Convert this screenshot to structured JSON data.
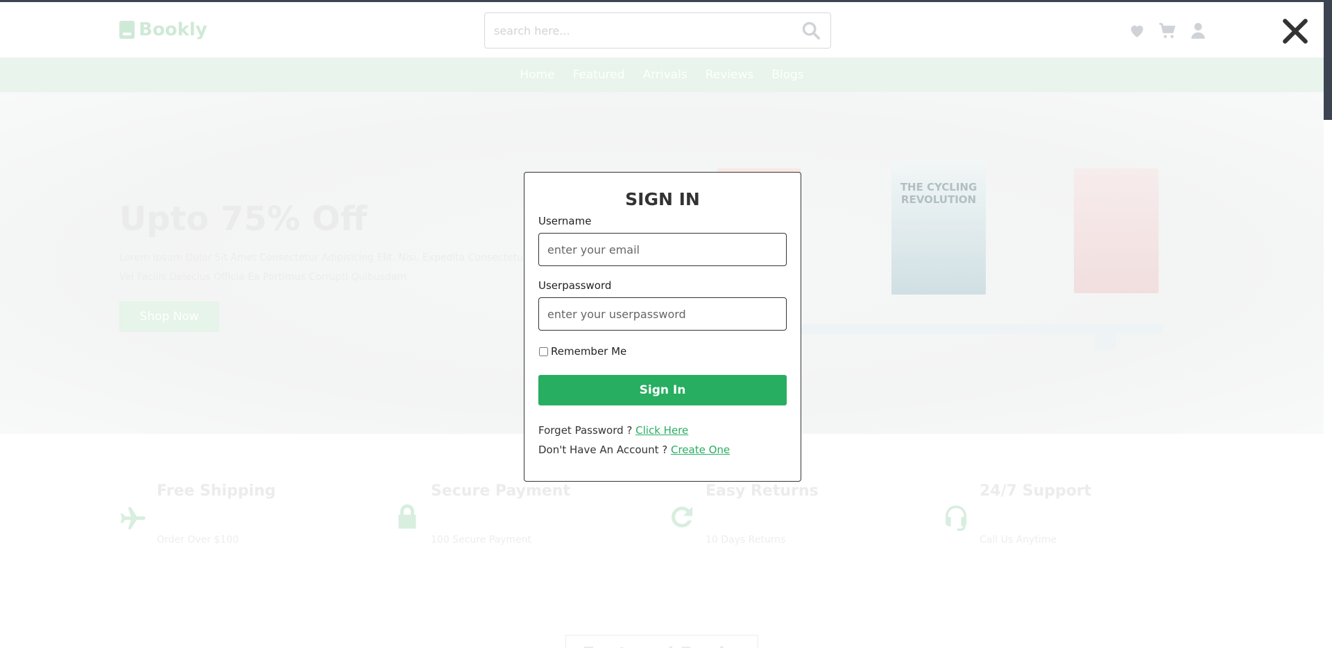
{
  "brand": {
    "name": "Bookly"
  },
  "search": {
    "placeholder": "search here..."
  },
  "nav": [
    "Home",
    "Featured",
    "Arrivals",
    "Reviews",
    "Blogs"
  ],
  "hero": {
    "title": "Upto 75% Off",
    "text": "Lorem Ipsum Dolor Sit Amet Consectetur Adipisicing Elit. Nisi, Expedita Consectetur Vel Facilis Deleclus Officia Ea Portimus Corrupti Quibusdam.",
    "button": "Shop Now",
    "book_title": "THE CYCLING REVOLUTION"
  },
  "features": [
    {
      "title": "Free Shipping",
      "subtitle": "Order Over $100",
      "icon": "plane-icon"
    },
    {
      "title": "Secure Payment",
      "subtitle": "100 Secure Payment",
      "icon": "lock-icon"
    },
    {
      "title": "Easy Returns",
      "subtitle": "10 Days Returns",
      "icon": "redo-icon"
    },
    {
      "title": "24/7 Support",
      "subtitle": "Call Us Anytime",
      "icon": "headset-icon"
    }
  ],
  "featured_heading": "Featured Books",
  "modal": {
    "title": "SIGN IN",
    "username_label": "Username",
    "username_placeholder": "enter your email",
    "password_label": "Userpassword",
    "password_placeholder": "enter your userpassword",
    "remember_label": "Remember Me",
    "submit_label": "Sign In",
    "forgot_text": "Forget Password ?",
    "forgot_link": "Click Here",
    "account_text": "Don't Have An Account ?",
    "account_link": "Create One"
  },
  "colors": {
    "accent": "#27ae60",
    "dark": "#333333",
    "nav_bg": "#e8f4ec"
  }
}
